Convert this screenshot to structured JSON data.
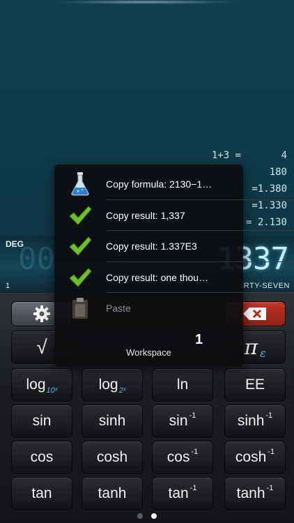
{
  "history": [
    {
      "expr": "1+3 =",
      "value": "4"
    },
    {
      "expr": "",
      "value": "180"
    },
    {
      "expr": "",
      "value": "=1.380"
    },
    {
      "expr": "",
      "value": "=1.330"
    },
    {
      "expr": "",
      "value": "= 2.130"
    }
  ],
  "history_more": "...",
  "display": {
    "mode": "DEG",
    "memory": "1",
    "value": "1337",
    "ghost": "00",
    "words": "IRTY-SEVEN"
  },
  "menu": {
    "items": [
      {
        "label": "Copy formula: 2130−1…",
        "icon": "flask-icon",
        "enabled": true
      },
      {
        "label": "Copy result: 1,337",
        "icon": "checkmark-icon",
        "enabled": true
      },
      {
        "label": "Copy result: 1.337E3",
        "icon": "checkmark-icon",
        "enabled": true
      },
      {
        "label": "Copy result: one thou…",
        "icon": "checkmark-icon",
        "enabled": true
      },
      {
        "label": "Paste",
        "icon": "clipboard-icon",
        "enabled": false
      }
    ],
    "workspace_label": "Workspace",
    "workspace_number": "1"
  },
  "keys": {
    "settings": "gear-icon",
    "delete": "delete-icon",
    "sqrt": "√",
    "pi": "π",
    "epsilon": "ε",
    "log": "log",
    "log_base": "10ˣ",
    "log2": "log",
    "log2_base": "2ˣ",
    "ln": "ln",
    "ee": "EE",
    "sin": "sin",
    "sinh": "sinh",
    "asin": "sin",
    "asinh": "sinh",
    "cos": "cos",
    "cosh": "cosh",
    "acos": "cos",
    "acosh": "cosh",
    "tan": "tan",
    "tanh": "tanh",
    "atan": "tan",
    "atanh": "tanh",
    "inv": "-1"
  },
  "pager": {
    "pages": 2,
    "active": 2
  },
  "colors": {
    "accent": "#58b6e5",
    "delete": "#c0392b",
    "check": "#6fbf2e"
  }
}
